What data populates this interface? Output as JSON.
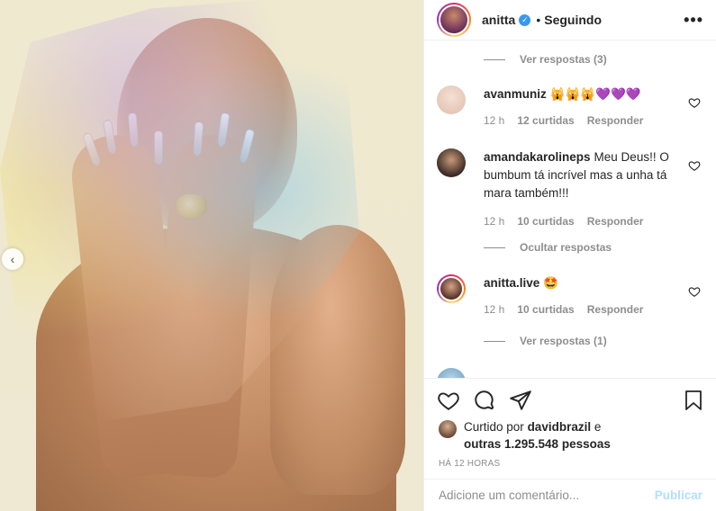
{
  "post": {
    "username": "anitta",
    "dot": "•",
    "following_label": "Seguindo",
    "more_label": "•••"
  },
  "comments": {
    "top_view_replies": "Ver respostas (3)",
    "items": [
      {
        "user": "avanmuniz",
        "text": "🙀🙀🙀💜💜💜",
        "time": "12 h",
        "likes": "12 curtidas",
        "reply": "Responder"
      },
      {
        "user": "amandakarolineps",
        "text": "Meu Deus!! O bumbum tá incrível mas a unha tá mara também!!!",
        "time": "12 h",
        "likes": "10 curtidas",
        "reply": "Responder"
      },
      {
        "user": "anitta.live",
        "text": "🤩",
        "time": "12 h",
        "likes": "10 curtidas",
        "reply": "Responder"
      }
    ],
    "hide_replies": "Ocultar respostas",
    "view_replies_bottom": "Ver respostas (1)"
  },
  "likes": {
    "prefix": "Curtido por",
    "user": "davidbrazil",
    "suffix": "e",
    "others": "outras 1.295.548 pessoas"
  },
  "time_ago": "HÁ 12 HORAS",
  "add_comment": {
    "placeholder": "Adicione um comentário...",
    "publish": "Publicar"
  },
  "colors": {
    "verified": "#3897f0",
    "publish_disabled": "#b2dffc",
    "muted": "#8e8e8e"
  }
}
